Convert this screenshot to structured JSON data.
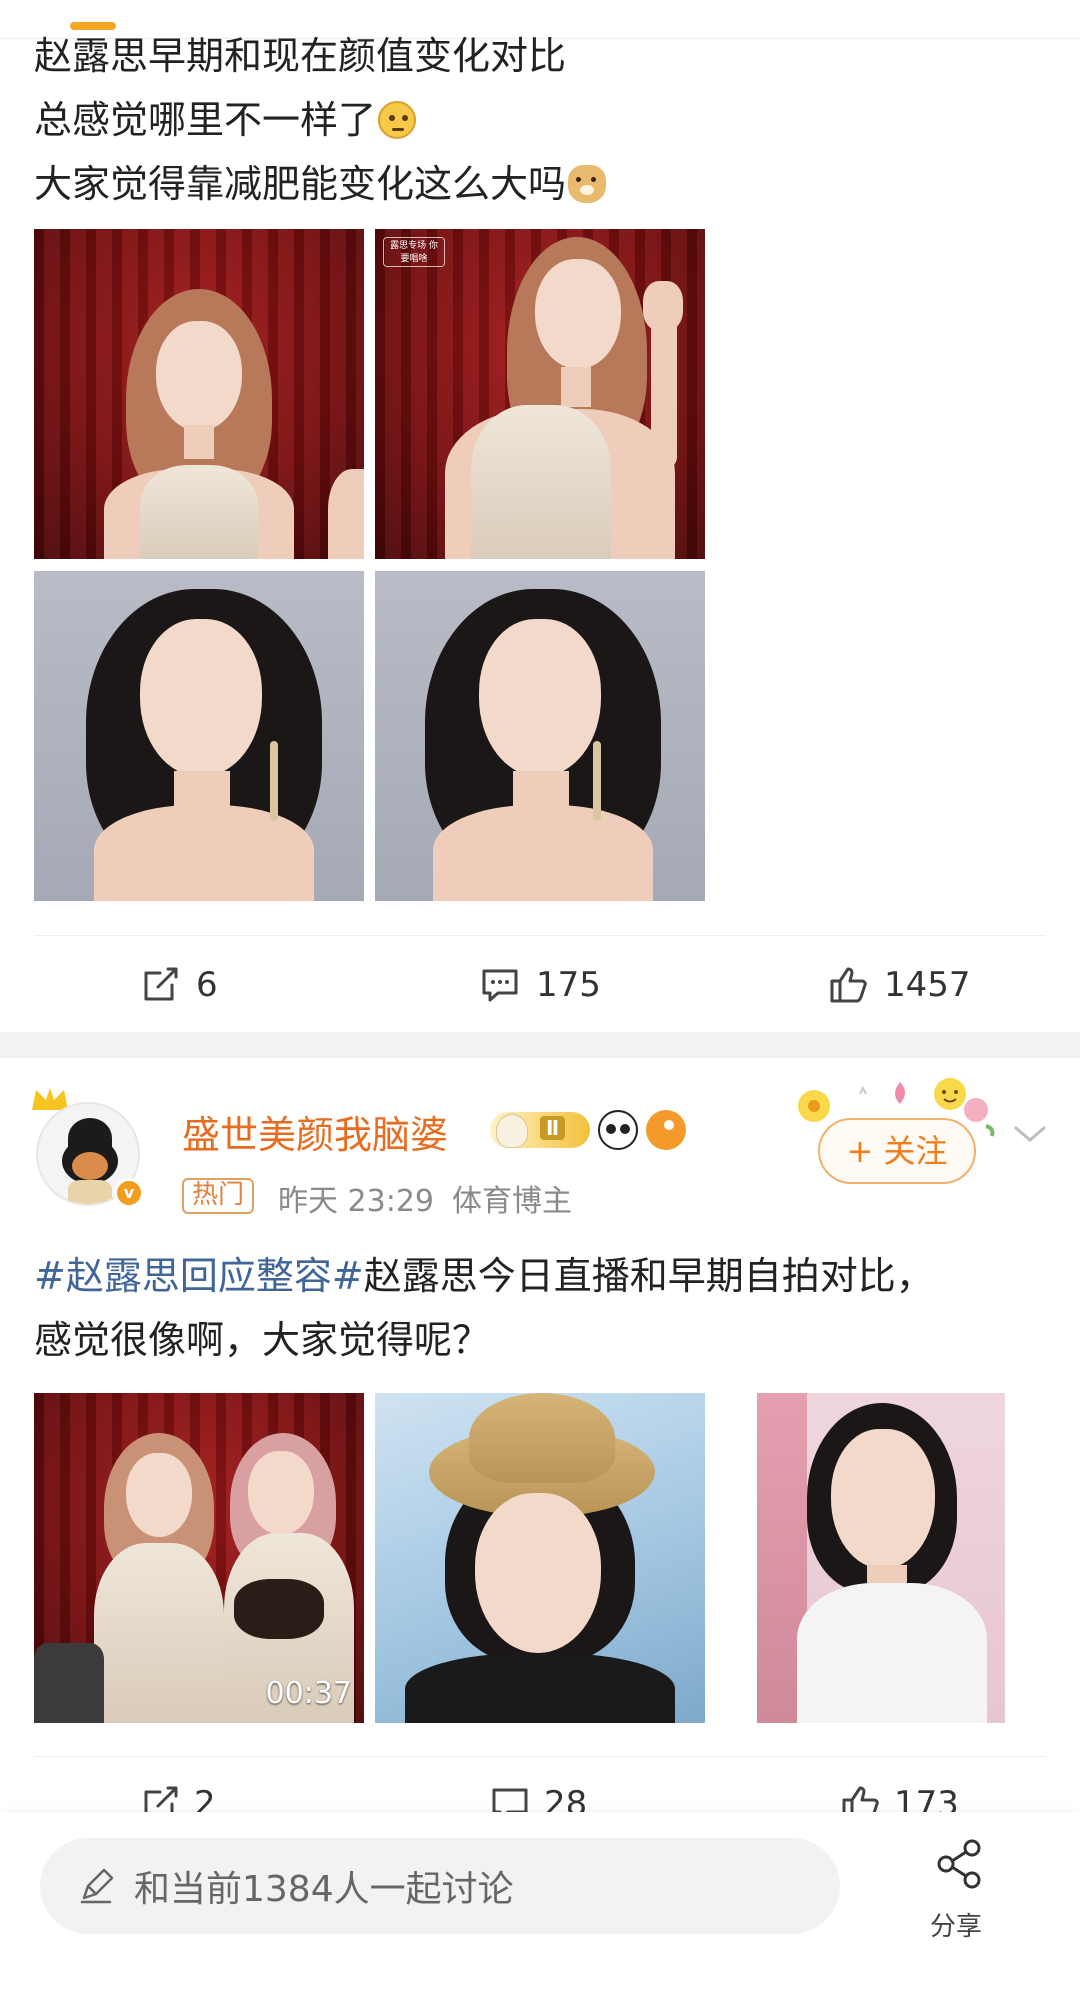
{
  "post1": {
    "text_lines": [
      "赵露思早期和现在颜值变化对比",
      "总感觉哪里不一样了",
      "大家觉得靠减肥能变化这么大吗"
    ],
    "emojis": [
      "thinking-emoji",
      "doge-emoji"
    ],
    "images": [
      {
        "name": "photo-1"
      },
      {
        "name": "photo-2",
        "overlay_text": "露思专场 你要唱啥"
      },
      {
        "name": "photo-3"
      },
      {
        "name": "photo-4"
      }
    ],
    "actions": {
      "repost": "6",
      "comment": "175",
      "like": "1457"
    }
  },
  "post2": {
    "username": "盛世美颜我脑婆",
    "level_badge": "Ⅱ",
    "tag": "热门",
    "time": "昨天 23:29",
    "role": "体育博主",
    "follow_label": "+ 关注",
    "hashtag": "#赵露思回应整容#",
    "text_after_hashtag": "赵露思今日直播和早期自拍对比，",
    "text_line2": "感觉很像啊，大家觉得呢？",
    "images": [
      {
        "name": "video-thumb",
        "duration": "00:37"
      },
      {
        "name": "selfie-hat"
      },
      {
        "name": "selfie-pink"
      }
    ],
    "actions": {
      "repost": "2",
      "comment": "28",
      "like": "173"
    }
  },
  "bottom": {
    "comment_placeholder": "和当前1384人一起讨论",
    "share_label": "分享"
  },
  "colors": {
    "accent": "#f5a623",
    "username": "#e86c1f",
    "hashtag": "#406599",
    "meta": "#8a8a8a"
  }
}
